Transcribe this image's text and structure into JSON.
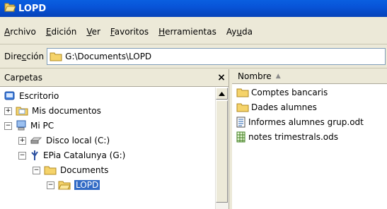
{
  "window": {
    "title": "LOPD"
  },
  "menu": [
    {
      "label": "Archivo",
      "accel": "A",
      "rest": "rchivo"
    },
    {
      "label": "Edición",
      "accel": "E",
      "rest": "dición"
    },
    {
      "label": "Ver",
      "accel": "V",
      "rest": "er"
    },
    {
      "label": "Favoritos",
      "accel": "F",
      "rest": "avoritos"
    },
    {
      "label": "Herramientas",
      "accel": "H",
      "rest": "erramientas"
    },
    {
      "label": "Ayuda",
      "pre": "Ay",
      "accel": "u",
      "rest": "da"
    }
  ],
  "address": {
    "label_pre": "Dire",
    "label_accel": "c",
    "label_post": "ción",
    "value": "G:\\Documents\\LOPD"
  },
  "folders_panel": {
    "title": "Carpetas",
    "close": "×",
    "tree": [
      {
        "label": "Escritorio",
        "icon": "desktop-icon",
        "expander": ""
      },
      {
        "label": "Mis documentos",
        "icon": "my-documents-icon",
        "expander": "+"
      },
      {
        "label": "Mi PC",
        "icon": "my-computer-icon",
        "expander": "−"
      },
      {
        "label": "Disco local (C:)",
        "icon": "hard-drive-icon",
        "expander": "+"
      },
      {
        "label": "EPia Catalunya (G:)",
        "icon": "usb-drive-icon",
        "expander": "−"
      },
      {
        "label": "Documents",
        "icon": "folder-icon",
        "expander": "−"
      },
      {
        "label": "LOPD",
        "icon": "folder-open-icon",
        "expander": "−",
        "selected": true
      }
    ]
  },
  "files_panel": {
    "column": "Nombre",
    "items": [
      {
        "label": "Comptes bancaris",
        "icon": "folder-icon"
      },
      {
        "label": "Dades alumnes",
        "icon": "folder-icon"
      },
      {
        "label": "Informes alumnes grup.odt",
        "icon": "text-document-icon"
      },
      {
        "label": "notes trimestrals.ods",
        "icon": "spreadsheet-icon"
      }
    ]
  }
}
